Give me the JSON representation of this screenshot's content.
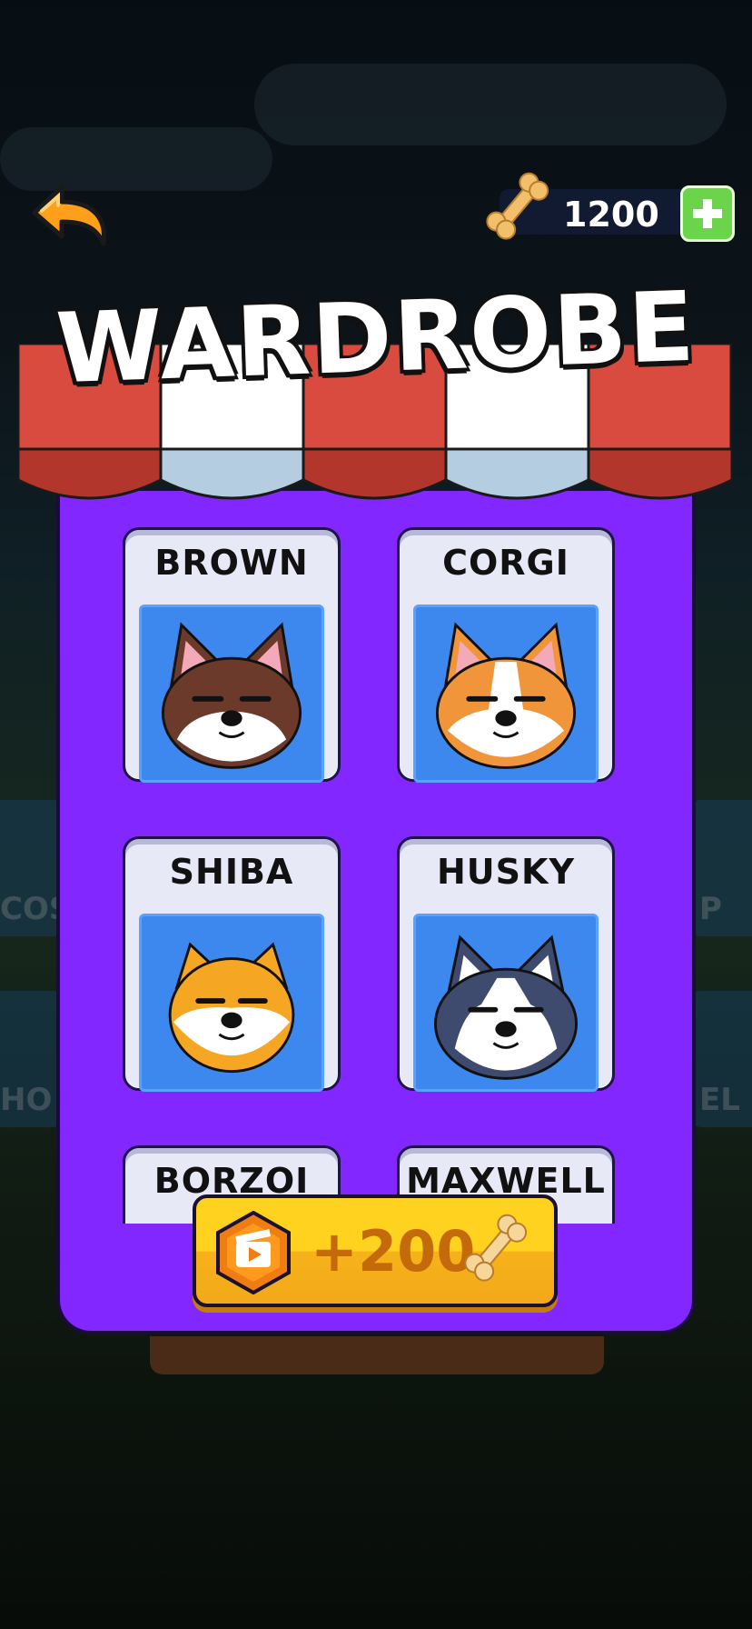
{
  "header": {
    "back_icon": "back-arrow-icon",
    "currency_icon": "bone-icon",
    "currency_value": "1200",
    "add_icon": "plus-icon"
  },
  "title": "WARDROBE",
  "background_tabs": [
    "COS",
    "HO",
    "P",
    "EL"
  ],
  "items": [
    {
      "label": "BROWN",
      "fur": "#6b3a2a",
      "accent": "#ffffff",
      "ear": "#f3a9b8"
    },
    {
      "label": "CORGI",
      "fur": "#f0953a",
      "accent": "#ffffff",
      "ear": "#f3a9b8"
    },
    {
      "label": "SHIBA",
      "fur": "#f5a623",
      "accent": "#ffffff",
      "ear": "#ffffff"
    },
    {
      "label": "HUSKY",
      "fur": "#3e4a6e",
      "accent": "#ffffff",
      "ear": "#ffffff"
    },
    {
      "label": "BORZOI"
    },
    {
      "label": "MAXWELL"
    }
  ],
  "ad_button": {
    "value": "+200",
    "icon": "video-ad-icon",
    "reward_icon": "bone-icon"
  },
  "colors": {
    "panel": "#8227ff",
    "card_bg": "#e8e9f7",
    "portrait_bg": "#3d88ee",
    "ad_button": "#ffd21f",
    "awning_red": "#d94b3f",
    "awning_white": "#ffffff"
  }
}
